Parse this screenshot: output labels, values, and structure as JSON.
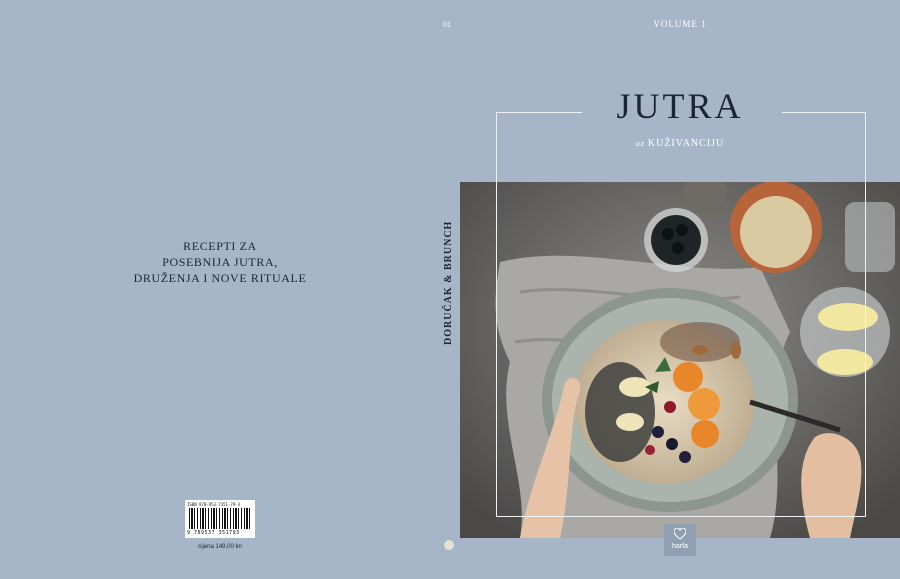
{
  "back_cover": {
    "lines": [
      "RECEPTI ZA",
      "POSEBNIJA JUTRA,",
      "DRUŽENJA I NOVE RITUALE"
    ],
    "isbn_text": "ISBN 978-953-7351-79-3",
    "barcode_digits": "9 789537 351793",
    "price": "cijena 149,00 kn"
  },
  "spine": {
    "number": "01",
    "text": "DORUČAK & BRUNCH"
  },
  "front_cover": {
    "volume": "VOLUME 1",
    "title": "JUTRA",
    "subtitle_prefix": "uz",
    "subtitle": "KUŽIVANCIJU",
    "publisher": "harfa"
  },
  "colors": {
    "background": "#a6b6c8",
    "text_dark": "#1d2433",
    "text_light": "#ffffff"
  }
}
